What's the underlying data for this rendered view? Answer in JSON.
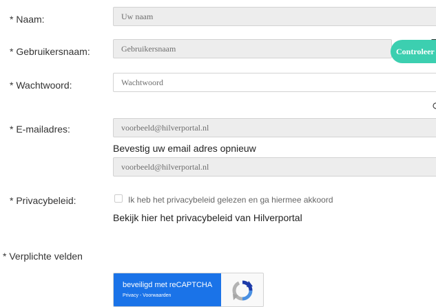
{
  "form": {
    "name": {
      "label": "* Naam:",
      "placeholder": "Uw naam",
      "value": ""
    },
    "username": {
      "label": "* Gebruikersnaam:",
      "placeholder": "Gebruikersnaam",
      "value": "",
      "check_button": "Controleer"
    },
    "password": {
      "label": "* Wachtwoord:",
      "placeholder": "Wachtwoord",
      "value": ""
    },
    "email": {
      "label": "* E-mailadres:",
      "placeholder": "voorbeeld@hilverportal.nl",
      "value": "",
      "confirm_label": "Bevestig uw email adres opnieuw",
      "confirm_placeholder": "voorbeeld@hilverportal.nl",
      "confirm_value": ""
    },
    "privacy": {
      "label": "* Privacybeleid:",
      "checkbox_label": "Ik heb het privacybeleid gelezen en ga hiermee akkoord",
      "checked": false,
      "link_text": "Bekijk hier het privacybeleid van Hilverportal"
    },
    "required_note": "* Verplichte velden"
  },
  "recaptcha": {
    "title": "beveiligd met reCAPTCHA",
    "links": "Privacy - Voorwaarden",
    "logo_icon": "recaptcha-logo-icon"
  },
  "colors": {
    "accent": "#3ccfb0",
    "recaptcha_blue": "#1a73e8",
    "field_bg": "#ededed",
    "field_border": "#d2d2d2"
  }
}
